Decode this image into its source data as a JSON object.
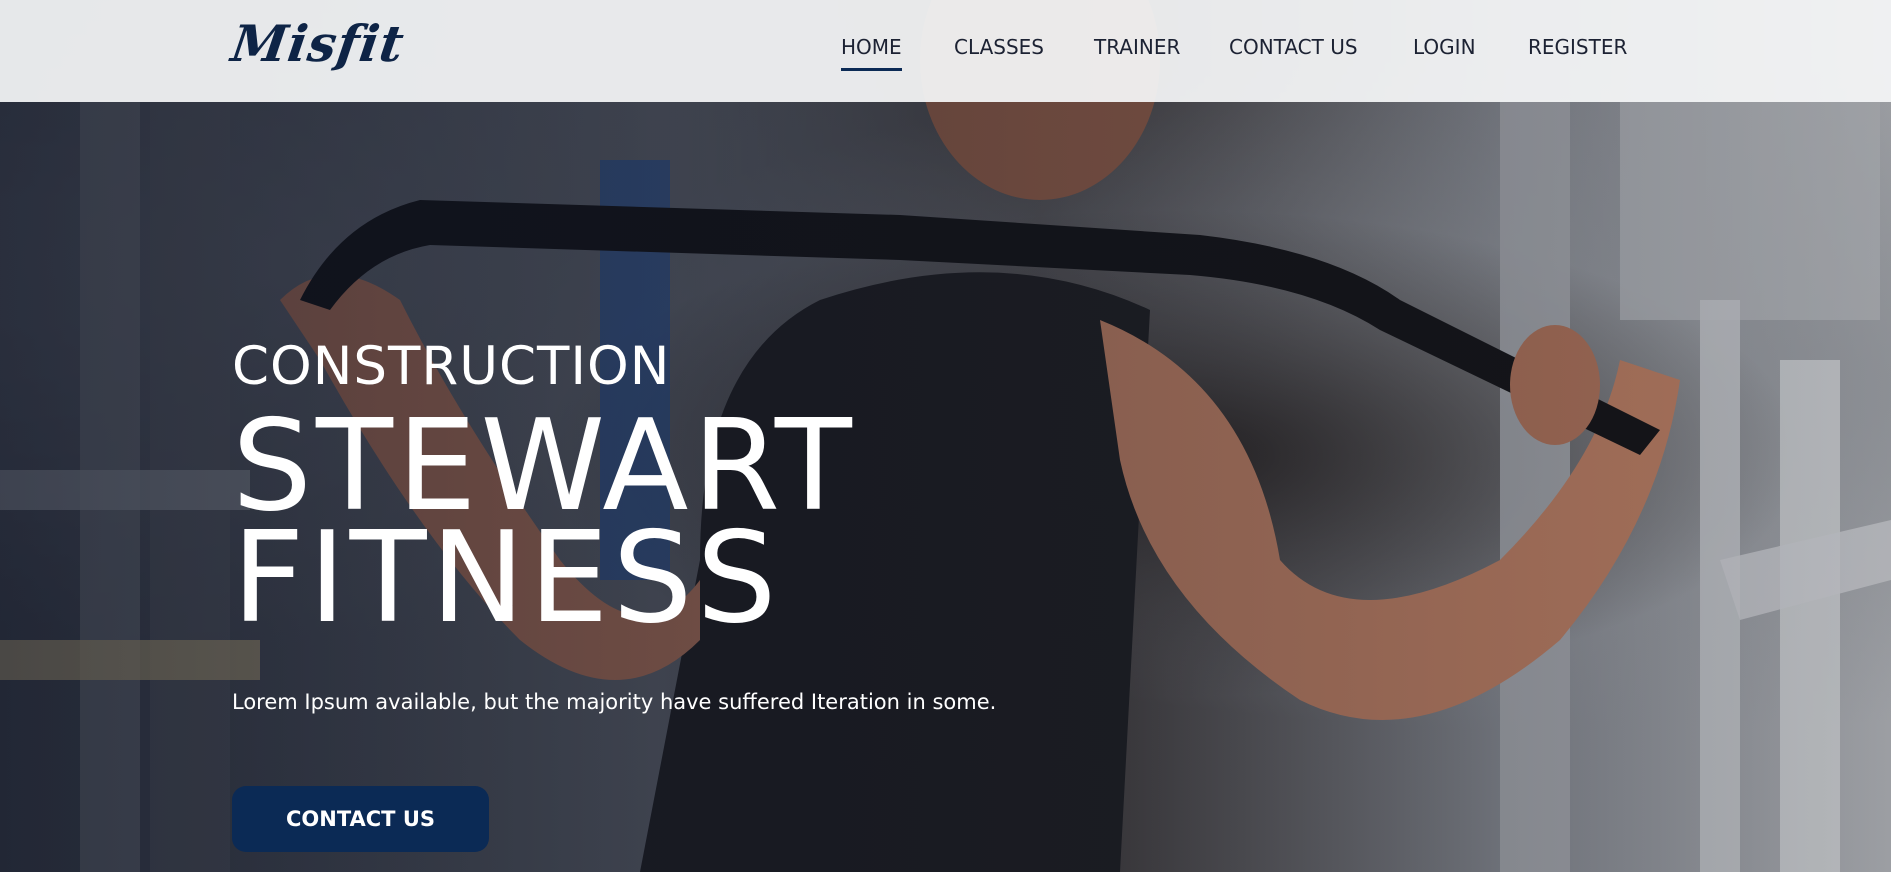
{
  "brand": {
    "logo_text": "Misfit"
  },
  "nav": {
    "items": [
      {
        "label": "HOME",
        "active": true
      },
      {
        "label": "CLASSES",
        "active": false
      },
      {
        "label": "TRAINER",
        "active": false
      },
      {
        "label": "CONTACT US",
        "active": false
      },
      {
        "label": "LOGIN",
        "active": false
      },
      {
        "label": "REGISTER",
        "active": false
      }
    ]
  },
  "hero": {
    "eyebrow": "CONSTRUCTION",
    "headline_line1": "STEWART",
    "headline_line2": "FITNESS",
    "subtext": "Lorem Ipsum available, but the majority have suffered Iteration in some.",
    "cta_label": "CONTACT US"
  },
  "colors": {
    "brand_navy": "#0b2a55",
    "header_bg": "#f5f6f8",
    "nav_text": "#1c2233",
    "hero_text": "#ffffff"
  }
}
